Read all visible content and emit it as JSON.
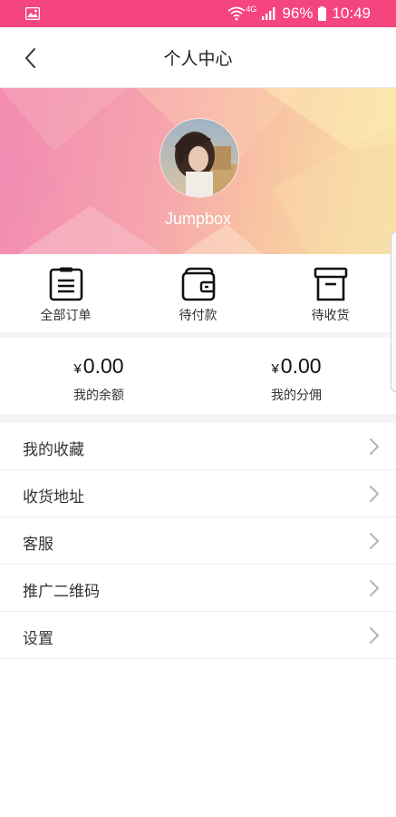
{
  "status_bar": {
    "left_icon": "image-notification-icon",
    "network": "4G",
    "battery_percent": "96%",
    "time": "10:49",
    "color": "#f5457f"
  },
  "header": {
    "title": "个人中心",
    "back_icon": "chevron-left-icon"
  },
  "profile": {
    "username": "Jumpbox",
    "avatar": "user-avatar-photo"
  },
  "orders": [
    {
      "label": "全部订单",
      "icon": "clipboard-list-icon"
    },
    {
      "label": "待付款",
      "icon": "wallet-icon"
    },
    {
      "label": "待收货",
      "icon": "archive-box-icon"
    }
  ],
  "balance": [
    {
      "currency": "¥",
      "amount": "0.00",
      "caption": "我的余额"
    },
    {
      "currency": "¥",
      "amount": "0.00",
      "caption": "我的分佣"
    }
  ],
  "menu": [
    {
      "label": "我的收藏"
    },
    {
      "label": "收货地址"
    },
    {
      "label": "客服"
    },
    {
      "label": "推广二维码"
    },
    {
      "label": "设置"
    }
  ],
  "colors": {
    "accent": "#f5457f",
    "banner_start": "#f28ab1",
    "banner_end": "#f6e6a8"
  }
}
